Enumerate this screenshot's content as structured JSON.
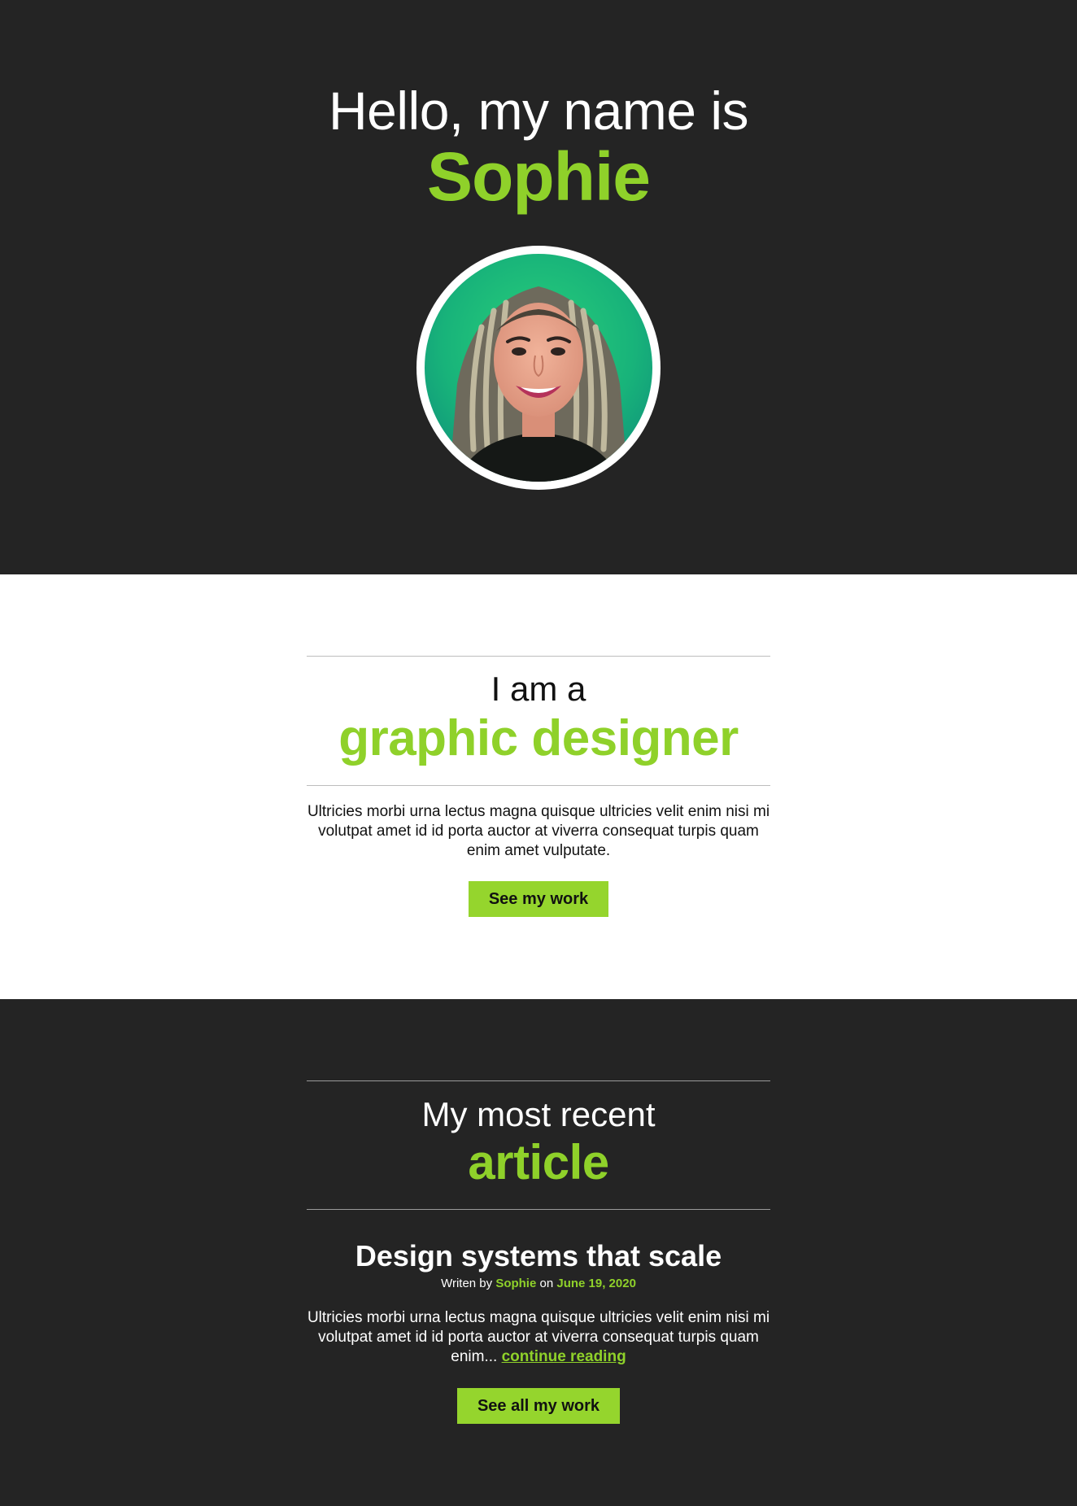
{
  "hero": {
    "intro": "Hello, my name is",
    "name": "Sophie",
    "avatar_alt": "Portrait of Sophie"
  },
  "about": {
    "intro": "I am a",
    "role": "graphic designer",
    "text": "Ultricies morbi urna lectus magna quisque ultricies velit enim nisi mi volutpat amet id id porta auctor at viverra consequat turpis quam enim amet vulputate.",
    "button_label": "See my work"
  },
  "articles": {
    "intro": "My most recent",
    "word": "article",
    "post": {
      "title": "Design systems that scale",
      "byline_prefix": "Writen by",
      "author": "Sophie",
      "byline_mid": "on",
      "date": "June 19, 2020",
      "excerpt": "Ultricies morbi urna lectus magna quisque ultricies velit enim nisi mi volutpat amet id id porta auctor at viverra consequat turpis quam enim...",
      "read_more": "continue reading"
    },
    "button_label": "See all my work"
  },
  "colors": {
    "accent": "#8fd12a",
    "dark_bg": "#242424",
    "light_bg": "#ffffff"
  }
}
